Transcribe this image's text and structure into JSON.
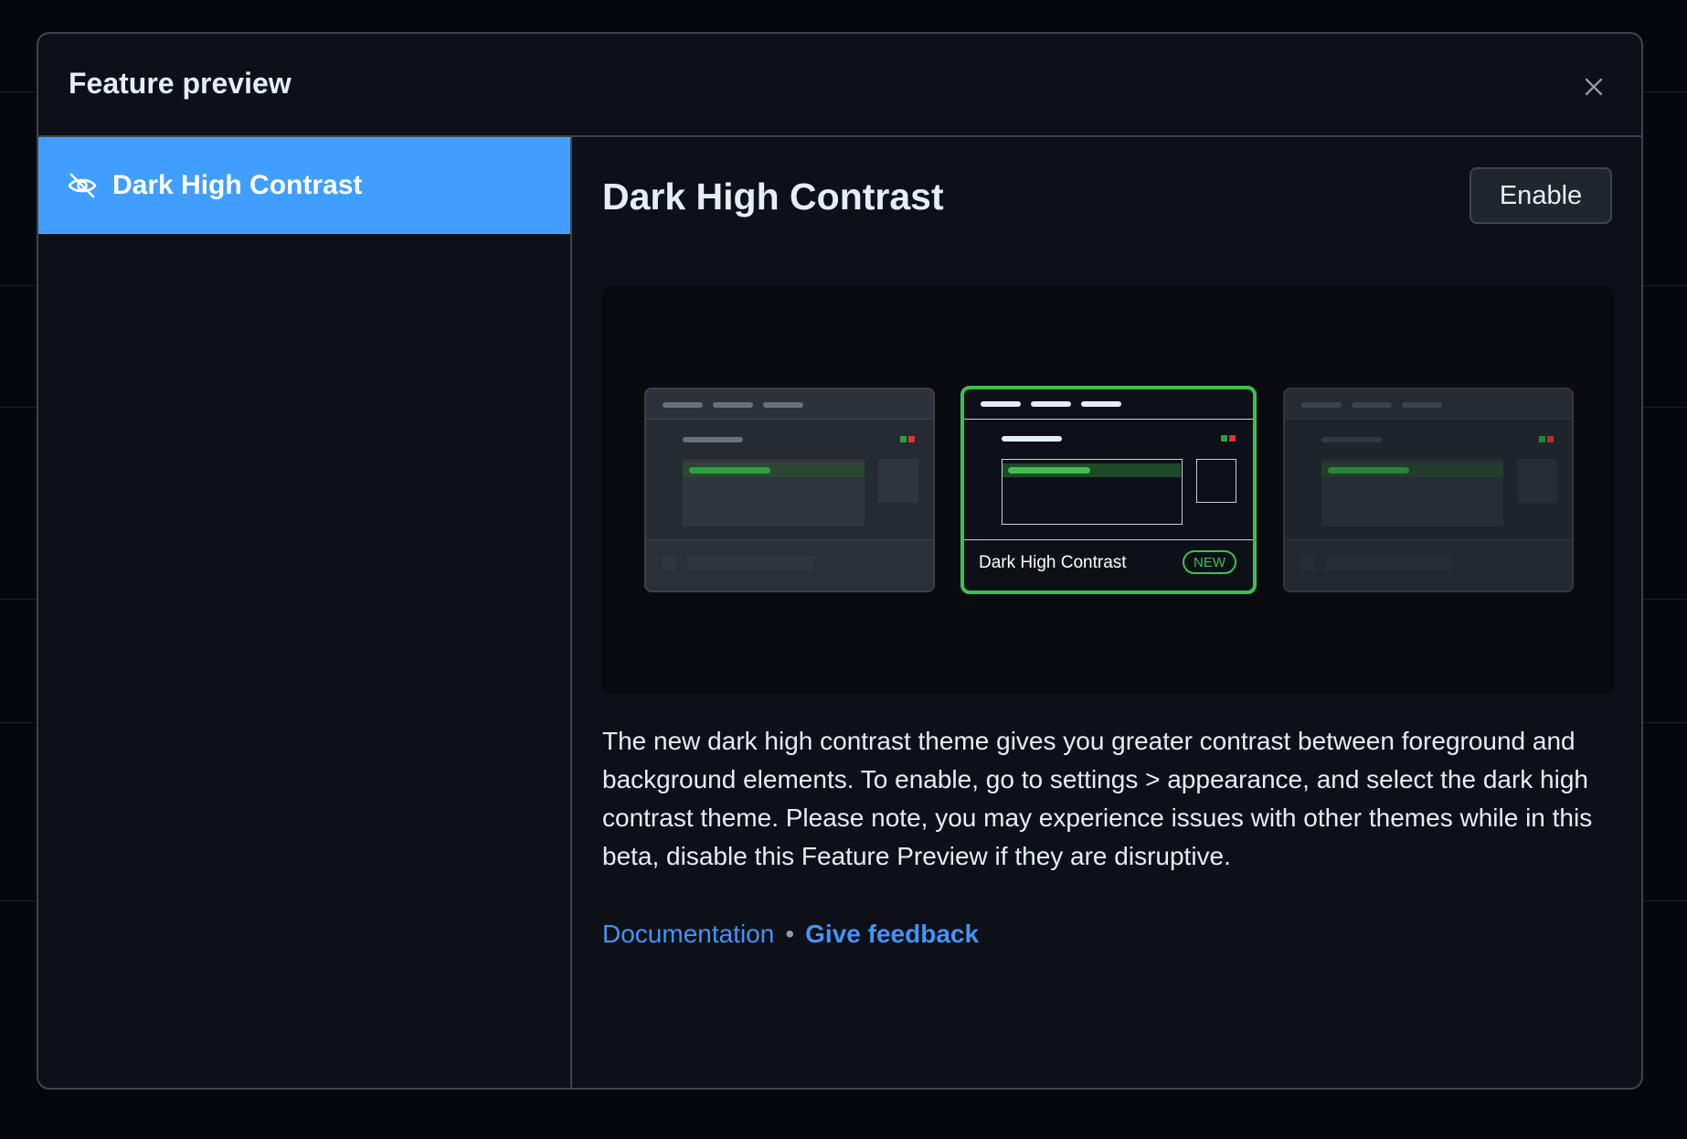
{
  "modal": {
    "title": "Feature preview",
    "close_icon": "close-icon"
  },
  "sidebar": {
    "items": [
      {
        "label": "Dark High Contrast",
        "icon": "eye-closed-icon",
        "selected": true
      }
    ]
  },
  "feature": {
    "title": "Dark High Contrast",
    "enable_label": "Enable",
    "preview_card_label": "Dark High Contrast",
    "preview_badge": "NEW",
    "description": "The new dark high contrast theme gives you greater contrast between foreground and background elements. To enable, go to settings > appearance, and select the dark high contrast theme. Please note, you may experience issues with other themes while in this beta, disable this Feature Preview if they are disruptive.",
    "links": {
      "documentation": "Documentation",
      "separator": "•",
      "feedback": "Give feedback"
    }
  },
  "colors": {
    "accent_selected": "#409eff",
    "link": "#4493f8",
    "success": "#3fbf4f",
    "modal_bg": "#0d1117",
    "border": "#3d444d"
  }
}
